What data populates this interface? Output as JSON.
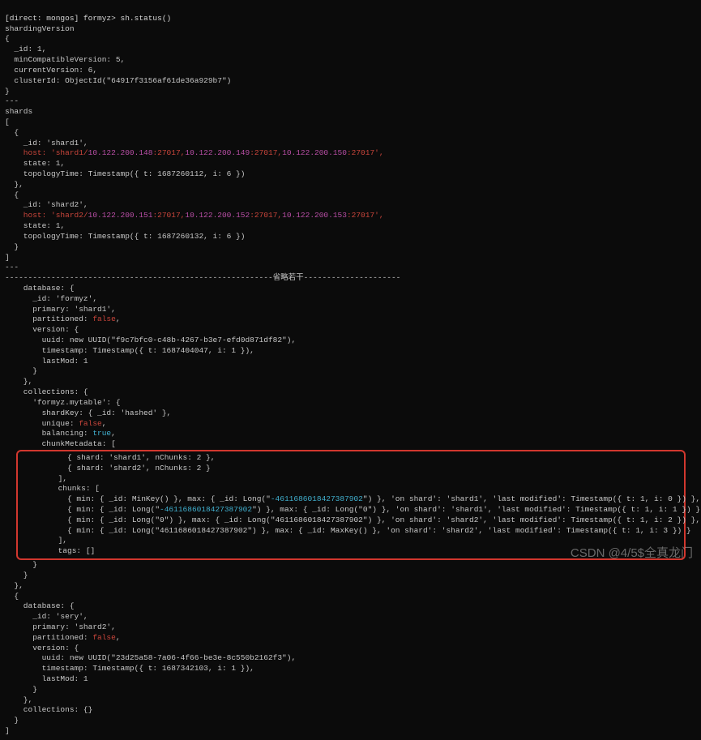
{
  "prompt_line": "[direct: mongos] formyz> sh.status()",
  "sharding_version_label": "shardingVersion",
  "open_brace": "{",
  "close_brace": "}",
  "sv": {
    "id": "  _id: 1,",
    "minCompat": "  minCompatibleVersion: 5,",
    "curVer": "  currentVersion: 6,",
    "clusterId": "  clusterId: ObjectId(\"64917f3156af61de36a929b7\")"
  },
  "dashes": "---",
  "shards_label": "shards",
  "bracket_open": "[",
  "bracket_close": "]",
  "shard1": {
    "open": "  {",
    "id": "    _id: 'shard1',",
    "host_pre": "    host: 'shard1/",
    "ip1": "10.122.200.148",
    "port": ":27017,",
    "ip2": "10.122.200.149",
    "ip3": "10.122.200.150",
    "port_end": ":27017',",
    "state": "    state: 1,",
    "topo": "    topologyTime: Timestamp({ t: 1687260112, i: 6 })",
    "close": "  },"
  },
  "shard2": {
    "open": "  {",
    "id": "    _id: 'shard2',",
    "host_pre": "    host: 'shard2/",
    "ip1": "10.122.200.151",
    "port": ":27017,",
    "ip2": "10.122.200.152",
    "ip3": "10.122.200.153",
    "port_end": ":27017',",
    "state": "    state: 1,",
    "topo": "    topologyTime: Timestamp({ t: 1687260132, i: 6 })",
    "close": "  }"
  },
  "divider_left": "----------------------------------------------------------省略若干---------------------",
  "db1": {
    "open": "    database: {",
    "id": "      _id: 'formyz',",
    "primary": "      primary: 'shard1',",
    "part_pre": "      partitioned: ",
    "part_val": "false",
    "comma": ",",
    "ver_open": "      version: {",
    "uuid": "        uuid: new UUID(\"f9c7bfc0-c48b-4267-b3e7-efd0d871df82\"),",
    "ts": "        timestamp: Timestamp({ t: 1687404047, i: 1 }),",
    "lastmod": "        lastMod: 1",
    "ver_close": "      }",
    "close": "    },",
    "coll_open": "    collections: {",
    "tbl_open": "      'formyz.mytable': {",
    "shardkey": "        shardKey: { _id: 'hashed' },",
    "unique_pre": "        unique: ",
    "unique_val": "false",
    "bal_pre": "        balancing: ",
    "bal_val": "true",
    "meta_open": "        chunkMetadata: ["
  },
  "box": {
    "m1": "          { shard: 'shard1', nChunks: 2 },",
    "m2": "          { shard: 'shard2', nChunks: 2 }",
    "m_close": "        ],",
    "chunks_open": "        chunks: [",
    "c1p1": "          { min: { _id: MinKey() }, max: { _id: Long(\"",
    "c1num": "-4611686018427387902",
    "c1p2": "\") }, 'on shard': 'shard1', 'last modified': Timestamp({ t: 1, i: 0 }) },",
    "c2p1": "          { min: { _id: Long(\"",
    "c2num": "-4611686018427387902",
    "c2p2": "\") }, max: { _id: Long(\"0\") }, 'on shard': 'shard1', 'last modified': Timestamp({ t: 1, i: 1 }) },",
    "c3": "          { min: { _id: Long(\"0\") }, max: { _id: Long(\"4611686018427387902\") }, 'on shard': 'shard2', 'last modified': Timestamp({ t: 1, i: 2 }) },",
    "c4": "          { min: { _id: Long(\"4611686018427387902\") }, max: { _id: MaxKey() }, 'on shard': 'shard2', 'last modified': Timestamp({ t: 1, i: 3 }) }",
    "chunks_close": "        ],",
    "tags": "        tags: []"
  },
  "db1close": {
    "tbl_close": "      }",
    "coll_close": "    }",
    "obj_close": "  },",
    "wrap_open": "  {"
  },
  "db2": {
    "open": "    database: {",
    "id": "      _id: 'sery',",
    "primary": "      primary: 'shard2',",
    "part_pre": "      partitioned: ",
    "part_val": "false",
    "comma": ",",
    "ver_open": "      version: {",
    "uuid": "        uuid: new UUID(\"23d25a58-7a06-4f66-be3e-8c550b2162f3\"),",
    "ts": "        timestamp: Timestamp({ t: 1687342103, i: 1 }),",
    "lastmod": "        lastMod: 1",
    "ver_close": "      }",
    "close": "    },",
    "coll": "    collections: {}",
    "obj_close": "  }",
    "final_bracket": "]"
  },
  "watermark": "CSDN @4/5$全真龙门"
}
